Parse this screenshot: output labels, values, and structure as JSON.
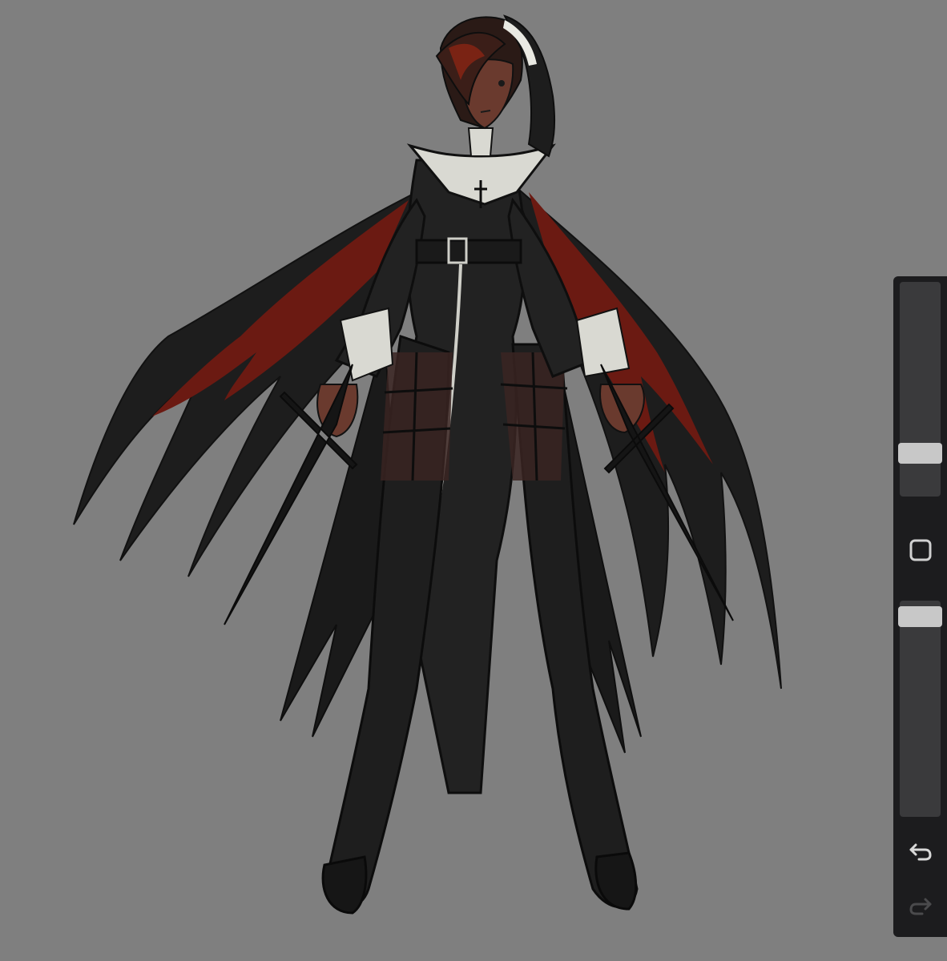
{
  "canvas": {
    "background": "#7f7f7f",
    "artwork": "character-illustration"
  },
  "sidebar": {
    "brush_size": {
      "value": 0.17
    },
    "modify_button": {
      "icon": "square-icon"
    },
    "brush_opacity": {
      "value": 0.97
    },
    "undo_button": {
      "icon": "undo-arrow-icon",
      "enabled": true
    },
    "redo_button": {
      "icon": "redo-arrow-icon",
      "enabled": false
    }
  },
  "colors": {
    "sidebar_bg": "#1c1c1e",
    "slider_track": "#3a3a3c",
    "slider_thumb": "#c8c8c8",
    "robe": "#1e1e1e",
    "hair_red": "#6b1a12",
    "collar": "#d9d9d2",
    "skin": "#6a3a2e"
  }
}
